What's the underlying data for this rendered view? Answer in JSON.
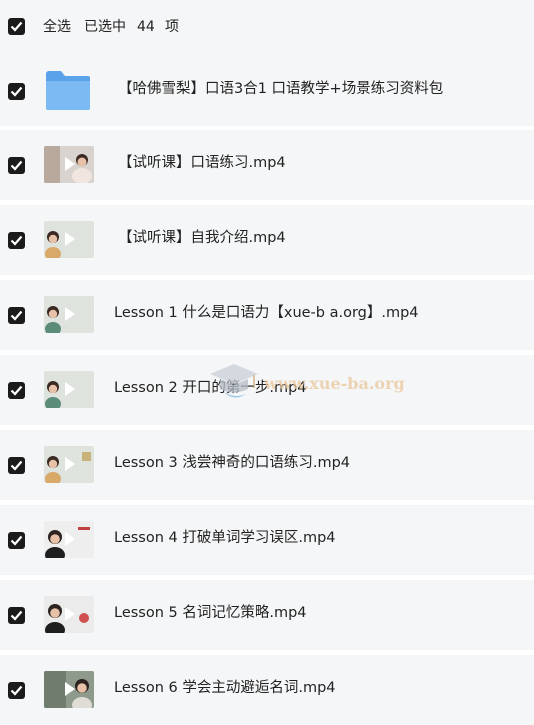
{
  "header": {
    "select_all": "全选",
    "selected_label": "已选中",
    "count": "44",
    "unit": "项"
  },
  "watermark": {
    "text": "www.xue-ba.org"
  },
  "colors": {
    "checkbox": "#1b1b1b",
    "row_bg": "#f5f6f7",
    "folder": "#6db0f0"
  },
  "files": [
    {
      "name": "【哈佛雪梨】口语3合1 口语教学+场景练习资料包",
      "type": "folder-icon",
      "checked": true
    },
    {
      "name": "【试听课】口语练习.mp4",
      "type": "video",
      "checked": true
    },
    {
      "name": "【试听课】自我介绍.mp4",
      "type": "video",
      "checked": true
    },
    {
      "name": "Lesson 1 什么是口语力【xue-b a.org】.mp4",
      "type": "video",
      "checked": true
    },
    {
      "name": "Lesson 2 开口的第一步.mp4",
      "type": "video",
      "checked": true
    },
    {
      "name": "Lesson 3 浅尝神奇的口语练习.mp4",
      "type": "video",
      "checked": true
    },
    {
      "name": "Lesson 4 打破单词学习误区.mp4",
      "type": "video",
      "checked": true
    },
    {
      "name": "Lesson 5 名词记忆策略.mp4",
      "type": "video",
      "checked": true
    },
    {
      "name": "Lesson 6 学会主动避逅名词.mp4",
      "type": "video",
      "checked": true
    }
  ]
}
